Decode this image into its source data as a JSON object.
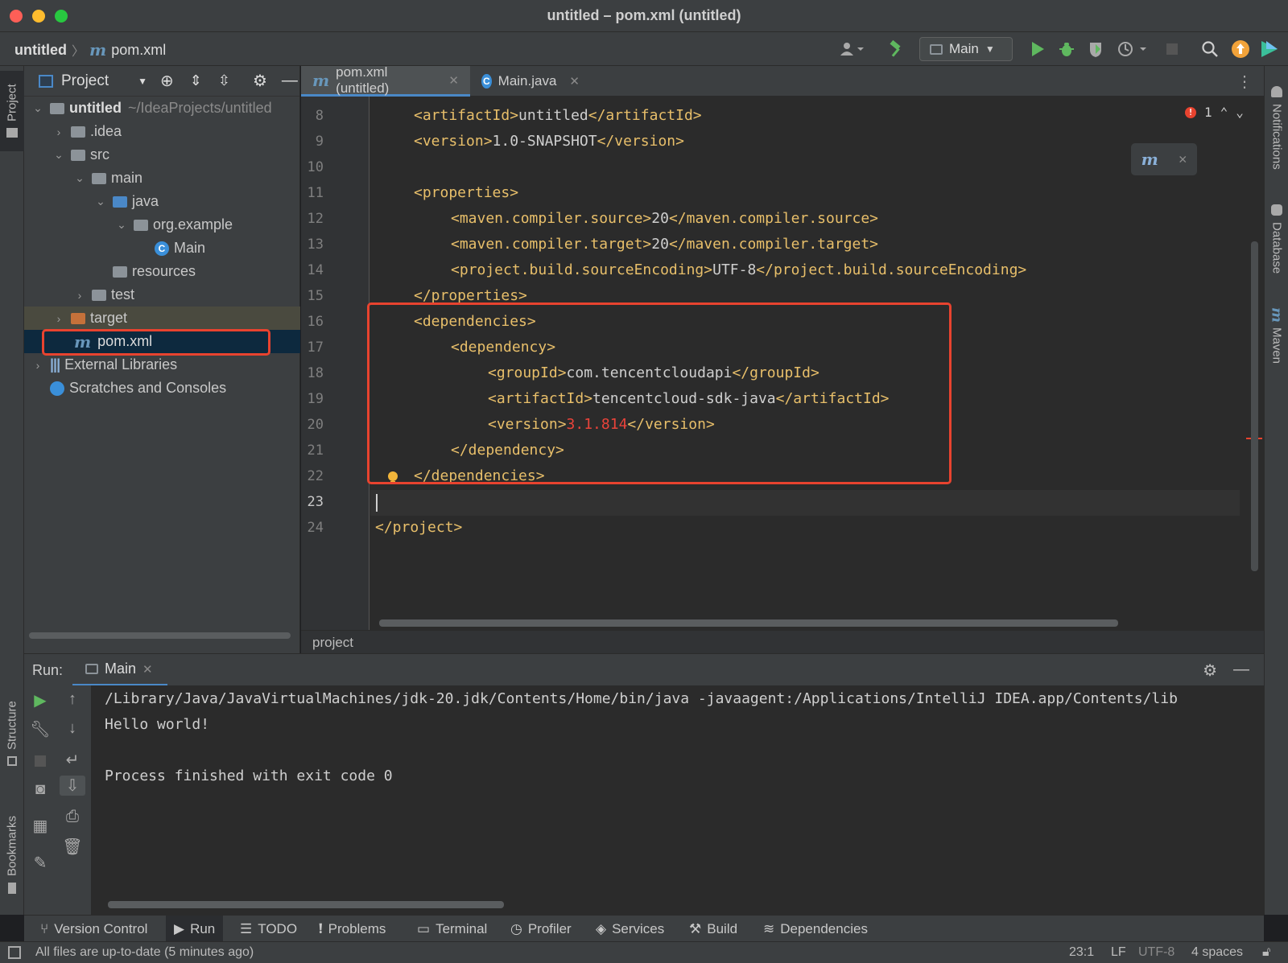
{
  "window": {
    "title": "untitled – pom.xml (untitled)"
  },
  "navbar": {
    "breadcrumb_project": "untitled",
    "breadcrumb_file": "pom.xml",
    "run_config": "Main"
  },
  "left_stripe": {
    "project_tab": "Project",
    "structure_tab": "Structure",
    "bookmarks_tab": "Bookmarks"
  },
  "right_stripe": {
    "notifications_tab": "Notifications",
    "database_tab": "Database",
    "maven_tab": "Maven"
  },
  "project_panel": {
    "title": "Project",
    "tree": [
      {
        "label": "untitled",
        "path": "~/IdeaProjects/untitled"
      },
      {
        "label": ".idea"
      },
      {
        "label": "src"
      },
      {
        "label": "main"
      },
      {
        "label": "java"
      },
      {
        "label": "org.example"
      },
      {
        "label": "Main"
      },
      {
        "label": "resources"
      },
      {
        "label": "test"
      },
      {
        "label": "target"
      },
      {
        "label": "pom.xml"
      },
      {
        "label": "External Libraries"
      },
      {
        "label": "Scratches and Consoles"
      }
    ]
  },
  "editor": {
    "tabs": [
      {
        "label": "pom.xml (untitled)",
        "active": true
      },
      {
        "label": "Main.java",
        "active": false
      }
    ],
    "error_count": "1",
    "line_numbers": [
      "8",
      "9",
      "10",
      "11",
      "12",
      "13",
      "14",
      "15",
      "16",
      "17",
      "18",
      "19",
      "20",
      "21",
      "22",
      "23",
      "24"
    ],
    "current_line": "23",
    "breadcrumb": "project",
    "lines": {
      "l8": {
        "open": "<artifactId>",
        "text": "untitled",
        "close": "</artifactId>"
      },
      "l9": {
        "open": "<version>",
        "text": "1.0-SNAPSHOT",
        "close": "</version>"
      },
      "l11": "<properties>",
      "l12": {
        "open": "<maven.compiler.source>",
        "text": "20",
        "close": "</maven.compiler.source>"
      },
      "l13": {
        "open": "<maven.compiler.target>",
        "text": "20",
        "close": "</maven.compiler.target>"
      },
      "l14": {
        "open": "<project.build.sourceEncoding>",
        "text": "UTF-8",
        "close": "</project.build.sourceEncoding>"
      },
      "l15": "</properties>",
      "l16": "<dependencies>",
      "l17": "<dependency>",
      "l18": {
        "open": "<groupId>",
        "text": "com.tencentcloudapi",
        "close": "</groupId>"
      },
      "l19": {
        "open": "<artifactId>",
        "text": "tencentcloud-sdk-java",
        "close": "</artifactId>"
      },
      "l20": {
        "open": "<version>",
        "text": "3.1.814",
        "close": "</version>"
      },
      "l21": "</dependency>",
      "l22": "</dependencies>",
      "l24": "</project>"
    }
  },
  "run_panel": {
    "label": "Run:",
    "tab": "Main",
    "console": [
      "/Library/Java/JavaVirtualMachines/jdk-20.jdk/Contents/Home/bin/java -javaagent:/Applications/IntelliJ IDEA.app/Contents/lib",
      "Hello world!",
      "",
      "Process finished with exit code 0"
    ]
  },
  "bottom_tabs": [
    {
      "label": "Version Control",
      "icon": "branch-icon"
    },
    {
      "label": "Run",
      "icon": "run-icon"
    },
    {
      "label": "TODO",
      "icon": "list-icon"
    },
    {
      "label": "Problems",
      "icon": "problems-icon"
    },
    {
      "label": "Terminal",
      "icon": "terminal-icon"
    },
    {
      "label": "Profiler",
      "icon": "profiler-icon"
    },
    {
      "label": "Services",
      "icon": "services-icon"
    },
    {
      "label": "Build",
      "icon": "hammer-icon"
    },
    {
      "label": "Dependencies",
      "icon": "layers-icon"
    }
  ],
  "status_bar": {
    "message": "All files are up-to-date (5 minutes ago)",
    "position": "23:1",
    "line_separator": "LF",
    "encoding": "UTF-8",
    "indent": "4 spaces"
  },
  "colors": {
    "highlight_box": "#e8432f",
    "tag": "#e8bf6a",
    "accent": "#4a88c7"
  }
}
